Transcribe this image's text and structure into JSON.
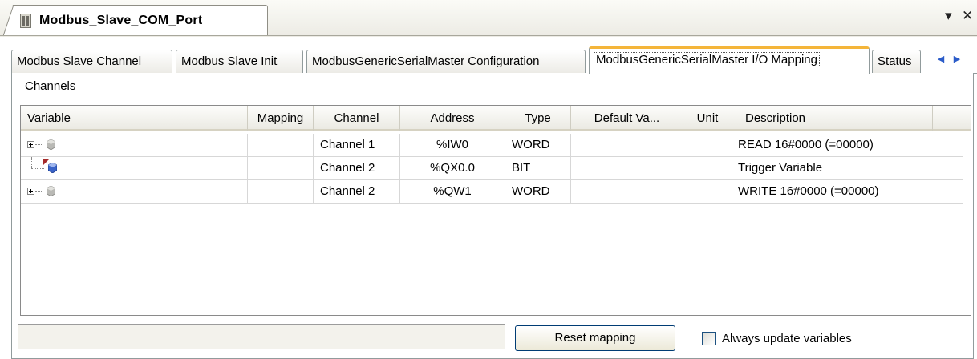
{
  "document": {
    "title": "Modbus_Slave_COM_Port",
    "controls": {
      "dropdown": "▾",
      "close": "✕"
    }
  },
  "tabs": [
    {
      "label": "Modbus Slave Channel",
      "active": false
    },
    {
      "label": "Modbus Slave Init",
      "active": false
    },
    {
      "label": "ModbusGenericSerialMaster Configuration",
      "active": false
    },
    {
      "label": "ModbusGenericSerialMaster I/O Mapping",
      "active": true
    },
    {
      "label": "Status",
      "active": false
    }
  ],
  "tab_scroll": {
    "left": "◀",
    "right": "▶"
  },
  "section": {
    "label": "Channels"
  },
  "grid": {
    "columns": [
      "Variable",
      "Mapping",
      "Channel",
      "Address",
      "Type",
      "Default Va...",
      "Unit",
      "Description"
    ],
    "rows": [
      {
        "variable": "",
        "mapping": "",
        "channel": "Channel 1",
        "address": "%IW0",
        "type": "WORD",
        "default": "",
        "unit": "",
        "description": "READ  16#0000 (=00000)",
        "icon": "gray-variable-icon",
        "expandable": true
      },
      {
        "variable": "",
        "mapping": "",
        "channel": "Channel 2",
        "address": "%QX0.0",
        "type": "BIT",
        "default": "",
        "unit": "",
        "description": "Trigger Variable",
        "icon": "blue-output-variable-icon",
        "expandable": false
      },
      {
        "variable": "",
        "mapping": "",
        "channel": "Channel 2",
        "address": "%QW1",
        "type": "WORD",
        "default": "",
        "unit": "",
        "description": "WRITE 16#0000 (=00000)",
        "icon": "gray-variable-icon",
        "expandable": true
      }
    ]
  },
  "footer": {
    "status_text": "",
    "reset_button": "Reset mapping",
    "always_update_label": "Always update variables",
    "always_update_checked": false
  },
  "colors": {
    "active_tab_accent": "#f4b53a",
    "button_border": "#003c74"
  }
}
